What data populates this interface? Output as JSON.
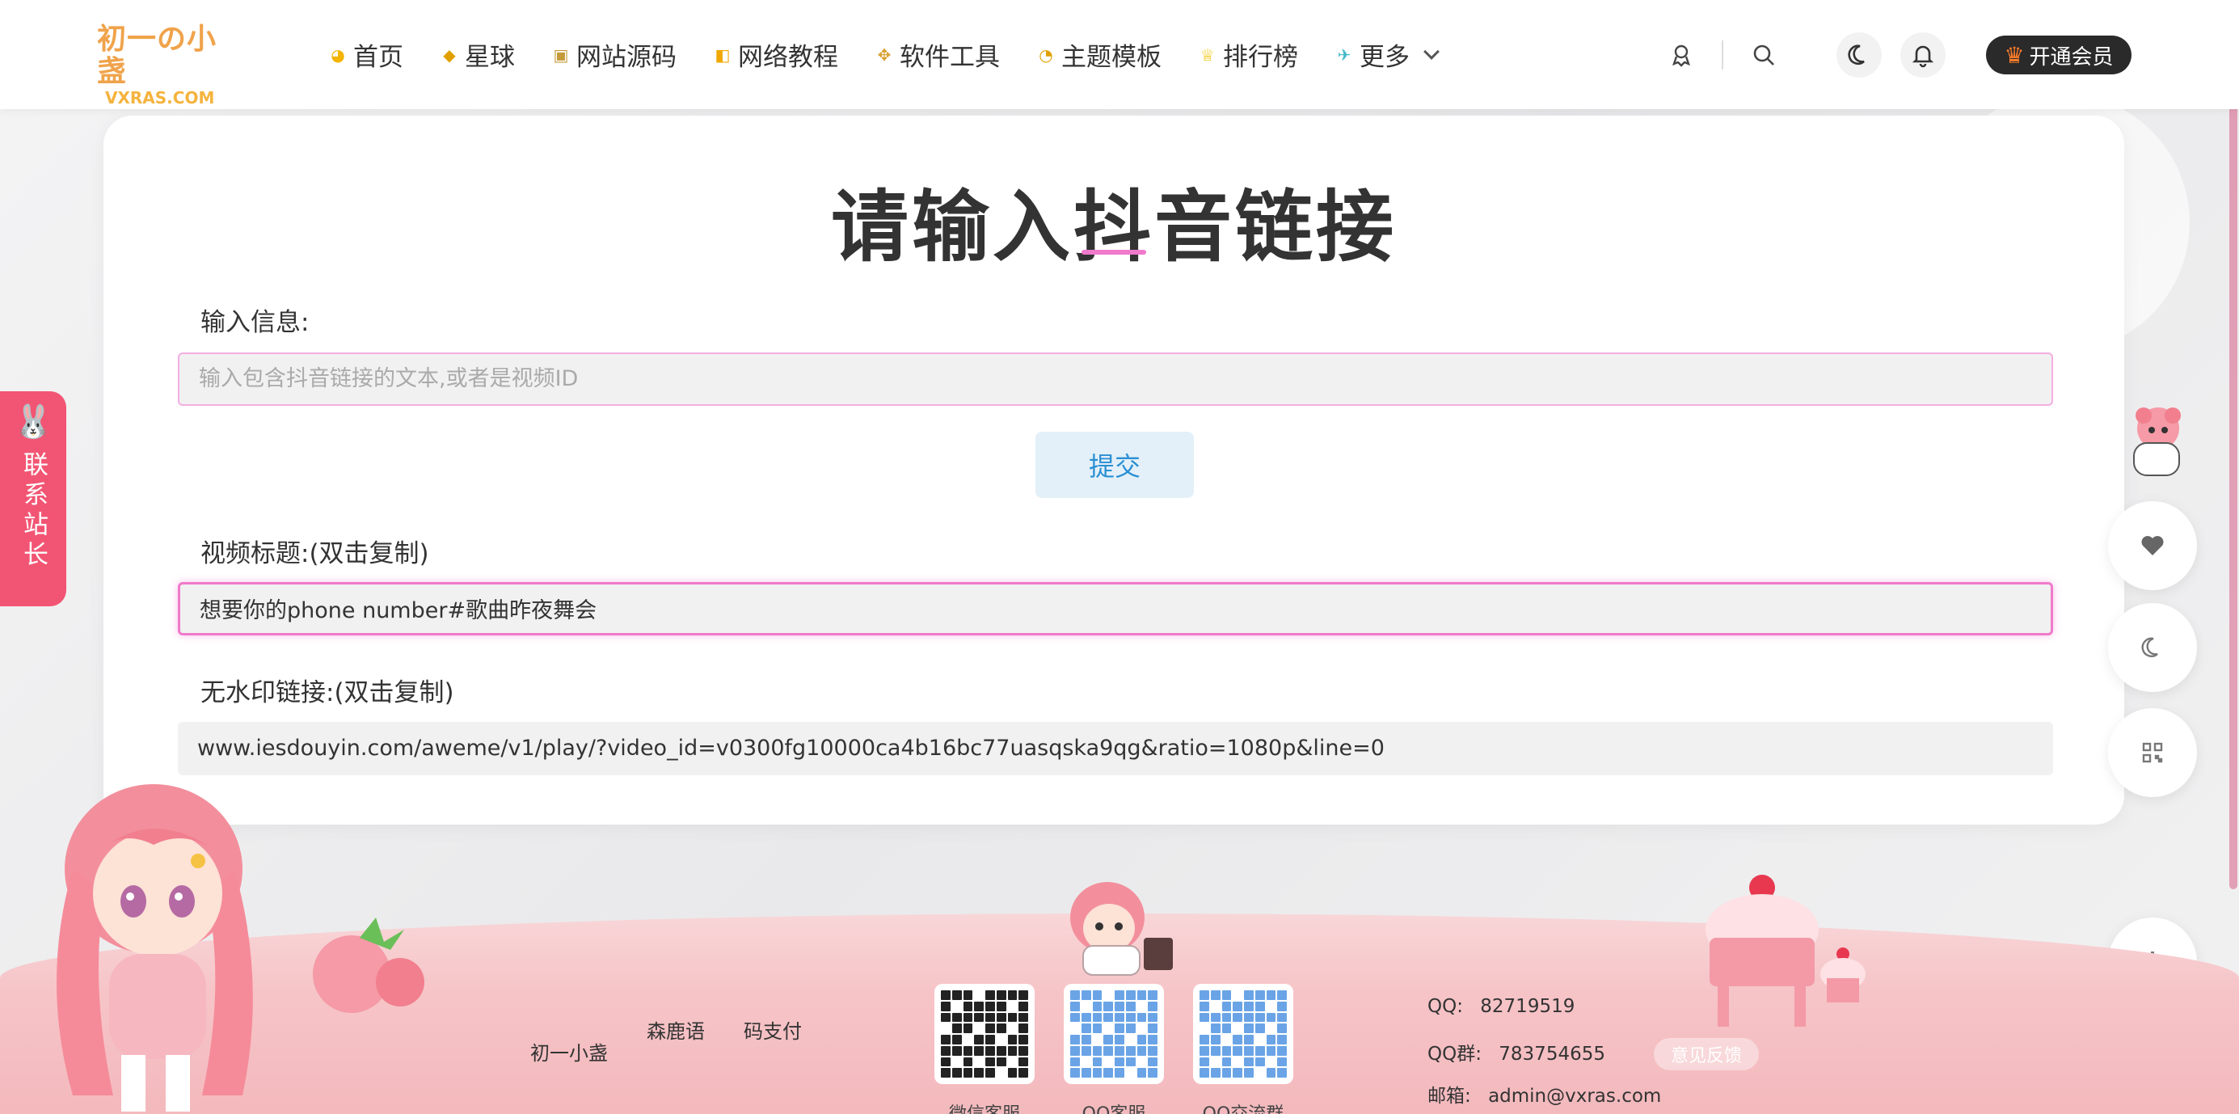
{
  "logo": {
    "line1": "初一の小盏",
    "line2": "VXRAS.COM"
  },
  "nav": {
    "items": [
      {
        "label": "首页",
        "icon": "home-icon",
        "glyph": "◕",
        "color": "#f4b400"
      },
      {
        "label": "星球",
        "icon": "planet-icon",
        "glyph": "◆",
        "color": "#f4b400"
      },
      {
        "label": "网站源码",
        "icon": "monitor-icon",
        "glyph": "▣",
        "color": "#c59a3a"
      },
      {
        "label": "网络教程",
        "icon": "tutorial-icon",
        "glyph": "◧",
        "color": "#f0a800"
      },
      {
        "label": "软件工具",
        "icon": "tools-icon",
        "glyph": "✥",
        "color": "#d9a030"
      },
      {
        "label": "主题模板",
        "icon": "palette-icon",
        "glyph": "◔",
        "color": "#e0a000"
      },
      {
        "label": "排行榜",
        "icon": "trophy-icon",
        "glyph": "♕",
        "color": "#f2c200"
      },
      {
        "label": "更多",
        "icon": "more-icon",
        "glyph": "✈",
        "color": "#42b8c9"
      }
    ],
    "vip_label": "开通会员",
    "vip_icon": "crown-icon"
  },
  "card": {
    "title": "请输入抖音链接",
    "input_label": "输入信息:",
    "input_placeholder": "输入包含抖音链接的文本,或者是视频ID",
    "submit_label": "提交",
    "video_title_label": "视频标题:(双击复制)",
    "video_title_value": "想要你的phone number#歌曲昨夜舞会",
    "nowatermark_label": "无水印链接:(双击复制)",
    "nowatermark_value": "www.iesdouyin.com/aweme/v1/play/?video_id=v0300fg10000ca4b16bc77uasqska9qg&ratio=1080p&line=0"
  },
  "contact_tab": {
    "text": "联系站长"
  },
  "footer": {
    "links": [
      "初一小盏",
      "森鹿语",
      "码支付"
    ],
    "qr_labels": [
      "微信客服",
      "QQ客服",
      "QQ交流群"
    ],
    "qq_label": "QQ:",
    "qq_value": "82719519",
    "qq_group_label": "QQ群:",
    "qq_group_value": "783754655",
    "email_label": "邮箱:",
    "email_value": "admin@vxras.com",
    "feedback_label": "意见反馈"
  },
  "colors": {
    "accent_pink": "#f07acb",
    "contact_red": "#f25573",
    "submit_blue": "#2a8fd3",
    "vip_dark": "#2a2a2a"
  }
}
